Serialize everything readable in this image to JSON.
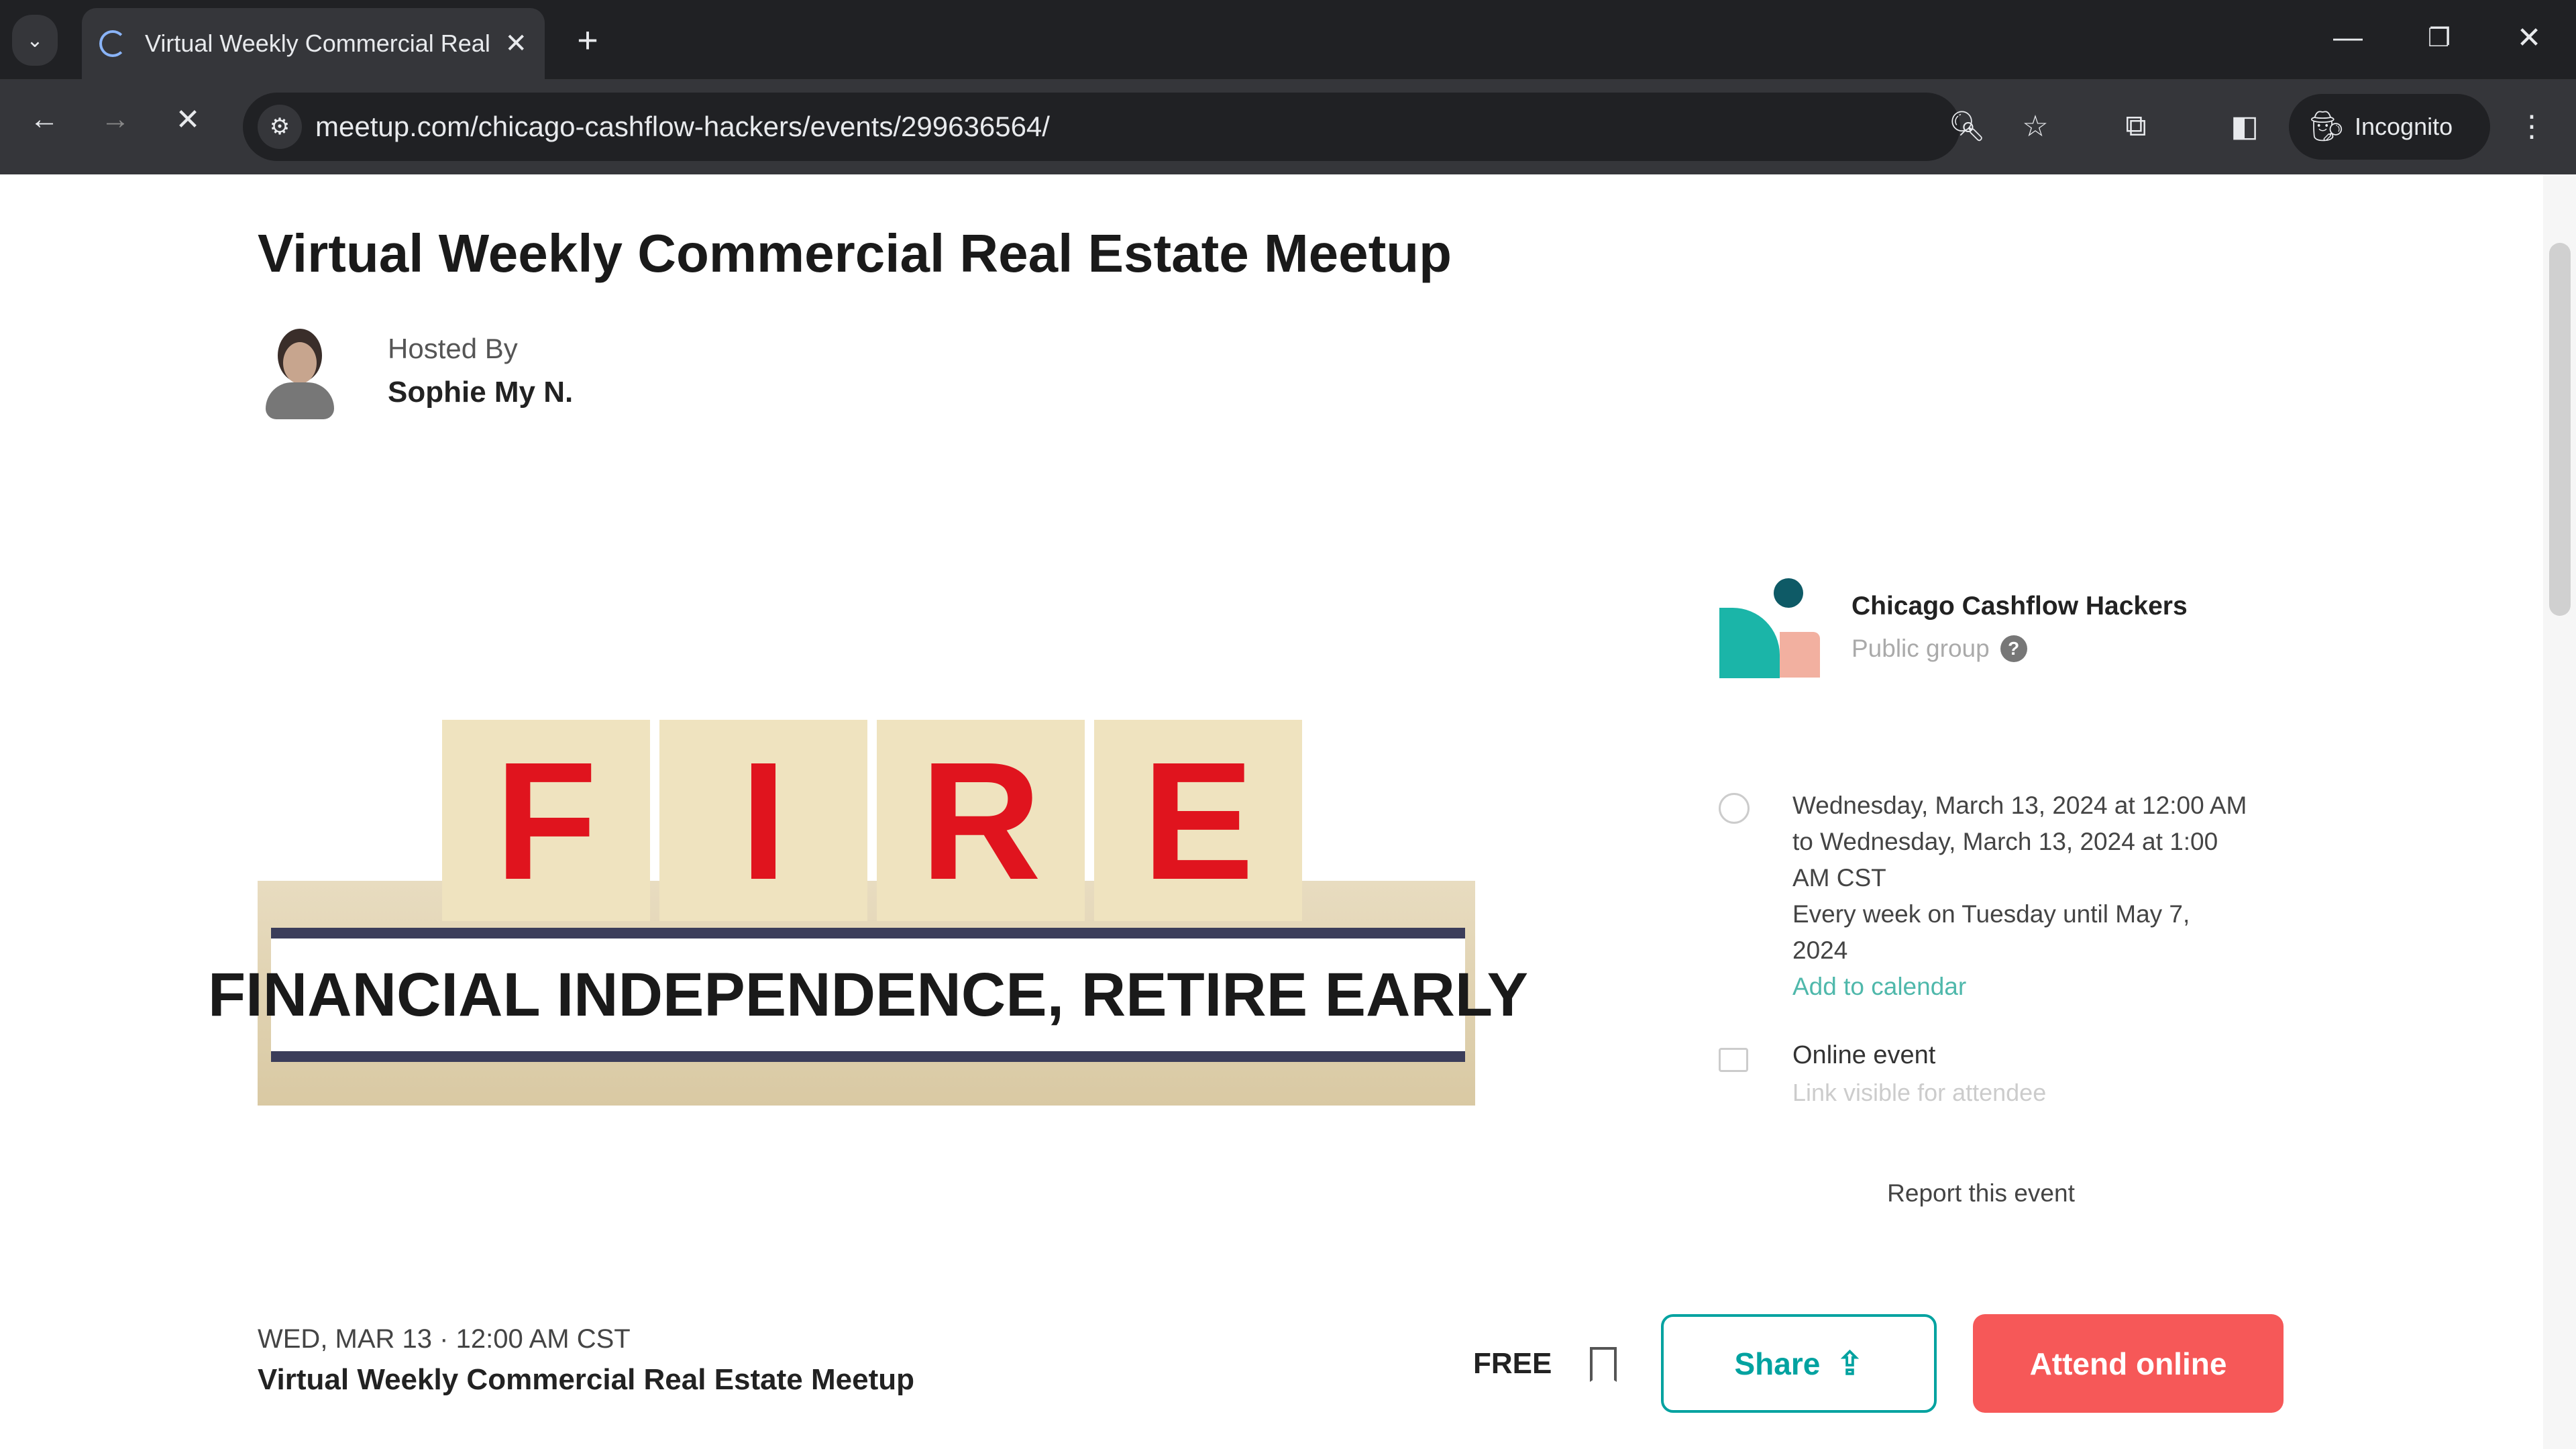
{
  "browser": {
    "tab_title": "Virtual Weekly Commercial Real",
    "url": "meetup.com/chicago-cashflow-hackers/events/299636564/",
    "incognito_label": "Incognito"
  },
  "event": {
    "title": "Virtual Weekly Commercial Real Estate Meetup",
    "hosted_by_label": "Hosted By",
    "host_name": "Sophie My N.",
    "image_letters": [
      "F",
      "I",
      "R",
      "E"
    ],
    "image_caption": "FINANCIAL INDEPENDENCE, RETIRE EARLY"
  },
  "group": {
    "name": "Chicago Cashflow Hackers",
    "type": "Public group"
  },
  "details": {
    "datetime": "Wednesday, March 13, 2024 at 12:00 AM to Wednesday, March 13, 2024 at 1:00 AM CST",
    "recurrence": "Every week on Tuesday until May 7, 2024",
    "add_to_calendar": "Add to calendar",
    "location": "Online event",
    "link_note": "Link visible for attendee"
  },
  "report_label": "Report this event",
  "footer": {
    "date": "WED, MAR 13 · 12:00 AM CST",
    "title": "Virtual Weekly Commercial Real Estate Meetup",
    "price": "FREE",
    "share_label": "Share",
    "attend_label": "Attend online"
  },
  "colors": {
    "accent": "#00a2a0",
    "attend": "#f65858",
    "teal_text": "#00798a"
  }
}
